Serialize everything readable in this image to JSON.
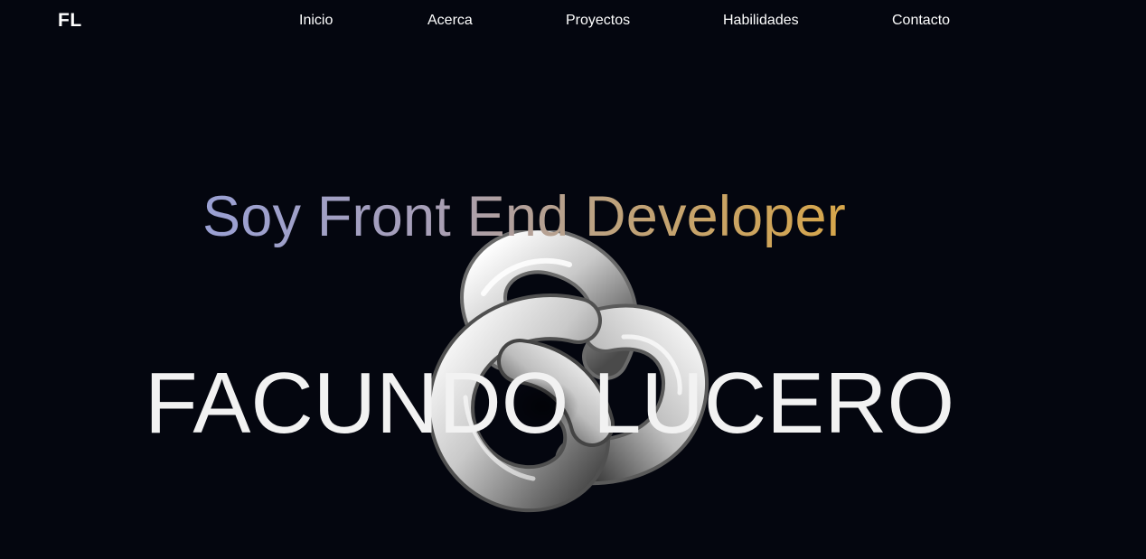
{
  "header": {
    "logo": "FL",
    "nav": [
      {
        "label": "Inicio"
      },
      {
        "label": "Acerca"
      },
      {
        "label": "Proyectos"
      },
      {
        "label": "Habilidades"
      },
      {
        "label": "Contacto"
      }
    ]
  },
  "hero": {
    "subtitle": "Soy Front End Developer",
    "name": "FACUNDO LUCERO",
    "graphic": "torus-knot-3d",
    "colors": {
      "background": "#04060f",
      "gradient_start": "#9aa0d4",
      "gradient_end": "#d7a64a",
      "name_text": "#f2f2f2"
    }
  }
}
